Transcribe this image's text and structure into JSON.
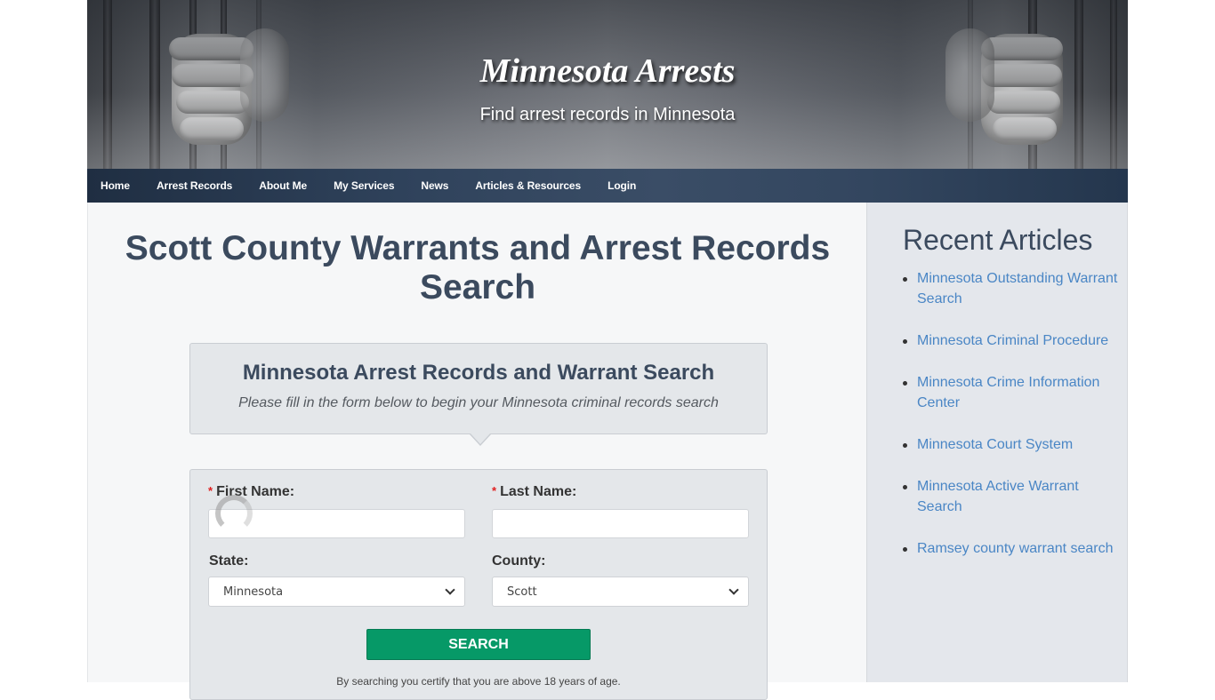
{
  "header": {
    "site_title": "Minnesota Arrests",
    "tagline": "Find arrest records in Minnesota",
    "banner_image": "hands-gripping-jail-bars"
  },
  "nav": {
    "items": [
      {
        "label": "Home"
      },
      {
        "label": "Arrest Records"
      },
      {
        "label": "About Me"
      },
      {
        "label": "My Services"
      },
      {
        "label": "News"
      },
      {
        "label": "Articles & Resources"
      },
      {
        "label": "Login"
      }
    ]
  },
  "main": {
    "page_title": "Scott County Warrants and Arrest Records Search",
    "intro": {
      "heading": "Minnesota Arrest Records and Warrant Search",
      "subheading": "Please fill in the form below to begin your Minnesota criminal records search"
    },
    "form": {
      "required_marker": "*",
      "first_name_label": "First Name:",
      "first_name_value": "",
      "last_name_label": "Last Name:",
      "last_name_value": "",
      "state_label": "State:",
      "state_value": "Minnesota",
      "county_label": "County:",
      "county_value": "Scott",
      "search_label": "SEARCH",
      "certification": "By searching you certify that you are above 18 years of age."
    }
  },
  "sidebar": {
    "heading": "Recent Articles",
    "articles": [
      {
        "label": "Minnesota Outstanding Warrant Search"
      },
      {
        "label": "Minnesota Criminal Procedure"
      },
      {
        "label": "Minnesota Crime Information Center"
      },
      {
        "label": "Minnesota Court System"
      },
      {
        "label": "Minnesota Active Warrant Search"
      },
      {
        "label": "Ramsey county warrant search"
      }
    ]
  },
  "colors": {
    "nav_bg": "#2f425b",
    "heading": "#3b4a5e",
    "link": "#4a86c5",
    "search_button": "#069967",
    "required": "#e02020"
  }
}
